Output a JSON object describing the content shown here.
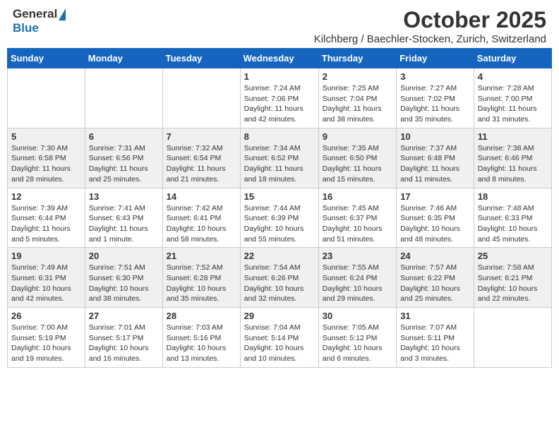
{
  "header": {
    "logo_general": "General",
    "logo_blue": "Blue",
    "title": "October 2025",
    "subtitle": "Kilchberg / Baechler-Stocken, Zurich, Switzerland"
  },
  "days_of_week": [
    "Sunday",
    "Monday",
    "Tuesday",
    "Wednesday",
    "Thursday",
    "Friday",
    "Saturday"
  ],
  "weeks": [
    {
      "days": [
        {
          "number": "",
          "info": ""
        },
        {
          "number": "",
          "info": ""
        },
        {
          "number": "",
          "info": ""
        },
        {
          "number": "1",
          "info": "Sunrise: 7:24 AM\nSunset: 7:06 PM\nDaylight: 11 hours and 42 minutes."
        },
        {
          "number": "2",
          "info": "Sunrise: 7:25 AM\nSunset: 7:04 PM\nDaylight: 11 hours and 38 minutes."
        },
        {
          "number": "3",
          "info": "Sunrise: 7:27 AM\nSunset: 7:02 PM\nDaylight: 11 hours and 35 minutes."
        },
        {
          "number": "4",
          "info": "Sunrise: 7:28 AM\nSunset: 7:00 PM\nDaylight: 11 hours and 31 minutes."
        }
      ]
    },
    {
      "days": [
        {
          "number": "5",
          "info": "Sunrise: 7:30 AM\nSunset: 6:58 PM\nDaylight: 11 hours and 28 minutes."
        },
        {
          "number": "6",
          "info": "Sunrise: 7:31 AM\nSunset: 6:56 PM\nDaylight: 11 hours and 25 minutes."
        },
        {
          "number": "7",
          "info": "Sunrise: 7:32 AM\nSunset: 6:54 PM\nDaylight: 11 hours and 21 minutes."
        },
        {
          "number": "8",
          "info": "Sunrise: 7:34 AM\nSunset: 6:52 PM\nDaylight: 11 hours and 18 minutes."
        },
        {
          "number": "9",
          "info": "Sunrise: 7:35 AM\nSunset: 6:50 PM\nDaylight: 11 hours and 15 minutes."
        },
        {
          "number": "10",
          "info": "Sunrise: 7:37 AM\nSunset: 6:48 PM\nDaylight: 11 hours and 11 minutes."
        },
        {
          "number": "11",
          "info": "Sunrise: 7:38 AM\nSunset: 6:46 PM\nDaylight: 11 hours and 8 minutes."
        }
      ]
    },
    {
      "days": [
        {
          "number": "12",
          "info": "Sunrise: 7:39 AM\nSunset: 6:44 PM\nDaylight: 11 hours and 5 minutes."
        },
        {
          "number": "13",
          "info": "Sunrise: 7:41 AM\nSunset: 6:43 PM\nDaylight: 11 hours and 1 minute."
        },
        {
          "number": "14",
          "info": "Sunrise: 7:42 AM\nSunset: 6:41 PM\nDaylight: 10 hours and 58 minutes."
        },
        {
          "number": "15",
          "info": "Sunrise: 7:44 AM\nSunset: 6:39 PM\nDaylight: 10 hours and 55 minutes."
        },
        {
          "number": "16",
          "info": "Sunrise: 7:45 AM\nSunset: 6:37 PM\nDaylight: 10 hours and 51 minutes."
        },
        {
          "number": "17",
          "info": "Sunrise: 7:46 AM\nSunset: 6:35 PM\nDaylight: 10 hours and 48 minutes."
        },
        {
          "number": "18",
          "info": "Sunrise: 7:48 AM\nSunset: 6:33 PM\nDaylight: 10 hours and 45 minutes."
        }
      ]
    },
    {
      "days": [
        {
          "number": "19",
          "info": "Sunrise: 7:49 AM\nSunset: 6:31 PM\nDaylight: 10 hours and 42 minutes."
        },
        {
          "number": "20",
          "info": "Sunrise: 7:51 AM\nSunset: 6:30 PM\nDaylight: 10 hours and 38 minutes."
        },
        {
          "number": "21",
          "info": "Sunrise: 7:52 AM\nSunset: 6:28 PM\nDaylight: 10 hours and 35 minutes."
        },
        {
          "number": "22",
          "info": "Sunrise: 7:54 AM\nSunset: 6:26 PM\nDaylight: 10 hours and 32 minutes."
        },
        {
          "number": "23",
          "info": "Sunrise: 7:55 AM\nSunset: 6:24 PM\nDaylight: 10 hours and 29 minutes."
        },
        {
          "number": "24",
          "info": "Sunrise: 7:57 AM\nSunset: 6:22 PM\nDaylight: 10 hours and 25 minutes."
        },
        {
          "number": "25",
          "info": "Sunrise: 7:58 AM\nSunset: 6:21 PM\nDaylight: 10 hours and 22 minutes."
        }
      ]
    },
    {
      "days": [
        {
          "number": "26",
          "info": "Sunrise: 7:00 AM\nSunset: 5:19 PM\nDaylight: 10 hours and 19 minutes."
        },
        {
          "number": "27",
          "info": "Sunrise: 7:01 AM\nSunset: 5:17 PM\nDaylight: 10 hours and 16 minutes."
        },
        {
          "number": "28",
          "info": "Sunrise: 7:03 AM\nSunset: 5:16 PM\nDaylight: 10 hours and 13 minutes."
        },
        {
          "number": "29",
          "info": "Sunrise: 7:04 AM\nSunset: 5:14 PM\nDaylight: 10 hours and 10 minutes."
        },
        {
          "number": "30",
          "info": "Sunrise: 7:05 AM\nSunset: 5:12 PM\nDaylight: 10 hours and 6 minutes."
        },
        {
          "number": "31",
          "info": "Sunrise: 7:07 AM\nSunset: 5:11 PM\nDaylight: 10 hours and 3 minutes."
        },
        {
          "number": "",
          "info": ""
        }
      ]
    }
  ]
}
